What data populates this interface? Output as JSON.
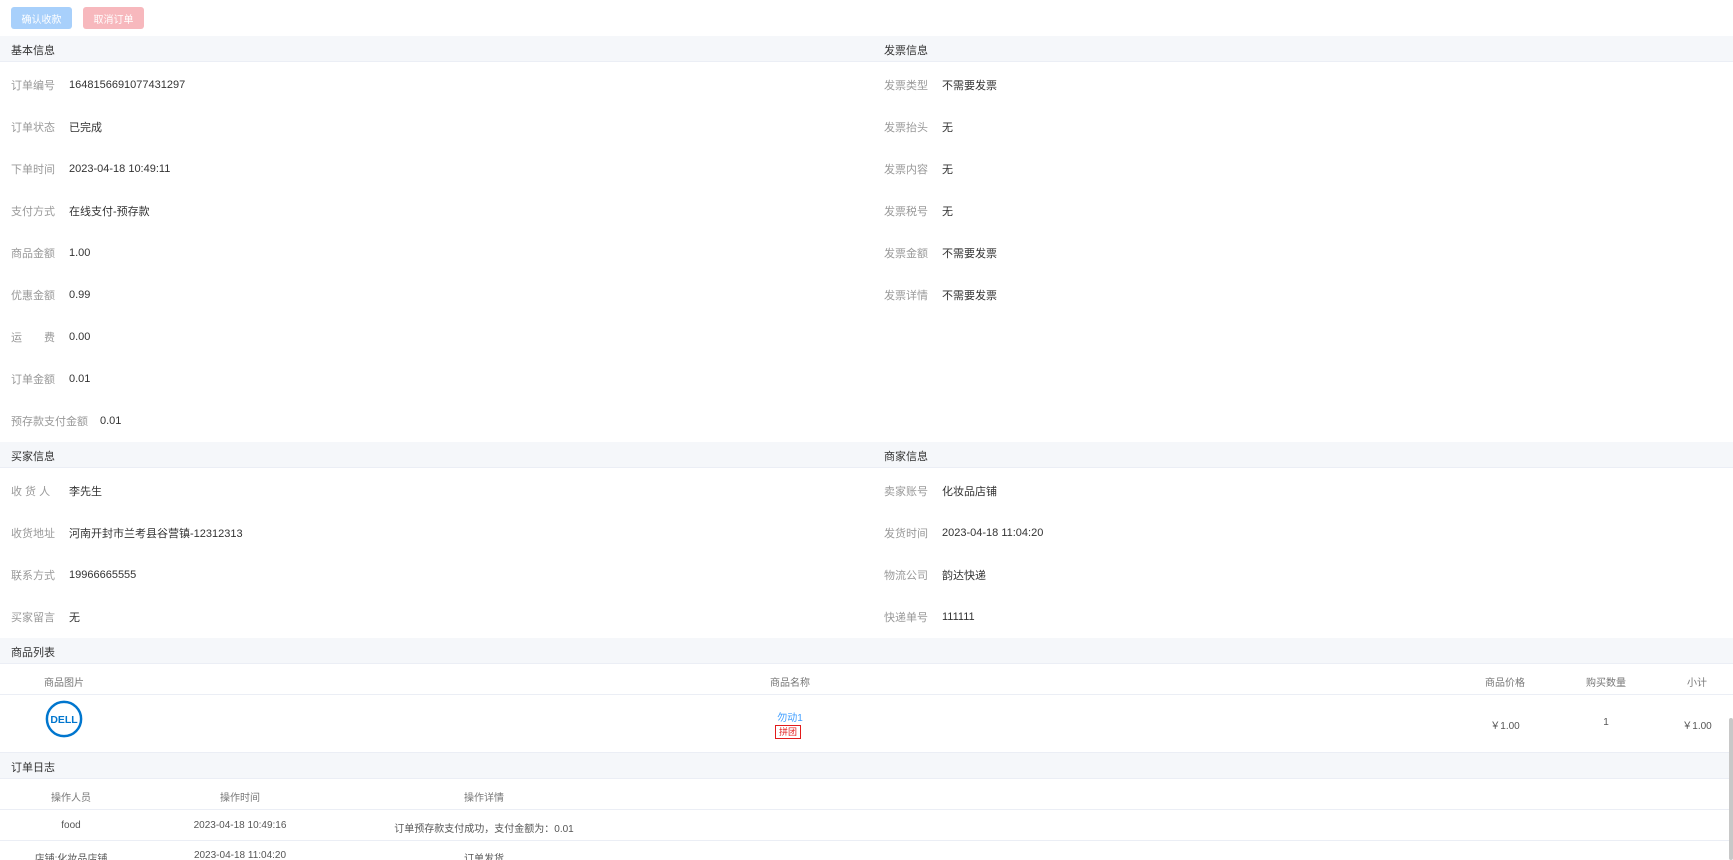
{
  "toolbar": {
    "confirm_label": "确认收款",
    "cancel_label": "取消订单"
  },
  "basic": {
    "title": "基本信息",
    "rows": [
      {
        "label": "订单编号",
        "value": "1648156691077431297"
      },
      {
        "label": "订单状态",
        "value": "已完成"
      },
      {
        "label": "下单时间",
        "value": "2023-04-18 10:49:11"
      },
      {
        "label": "支付方式",
        "value": "在线支付-预存款"
      },
      {
        "label": "商品金额",
        "value": "1.00"
      },
      {
        "label": "优惠金额",
        "value": "0.99"
      },
      {
        "label": "运　　费",
        "value": "0.00"
      },
      {
        "label": "订单金额",
        "value": "0.01"
      },
      {
        "label": "预存款支付金额",
        "value": "0.01"
      }
    ]
  },
  "invoice": {
    "title": "发票信息",
    "rows": [
      {
        "label": "发票类型",
        "value": "不需要发票"
      },
      {
        "label": "发票抬头",
        "value": "无"
      },
      {
        "label": "发票内容",
        "value": "无"
      },
      {
        "label": "发票税号",
        "value": "无"
      },
      {
        "label": "发票金额",
        "value": "不需要发票"
      },
      {
        "label": "发票详情",
        "value": "不需要发票"
      }
    ]
  },
  "buyer": {
    "title": "买家信息",
    "rows": [
      {
        "label": "收 货 人",
        "value": "李先生"
      },
      {
        "label": "收货地址",
        "value": "河南开封市兰考县谷营镇-12312313"
      },
      {
        "label": "联系方式",
        "value": "19966665555"
      },
      {
        "label": "买家留言",
        "value": "无"
      }
    ]
  },
  "seller": {
    "title": "商家信息",
    "rows": [
      {
        "label": "卖家账号",
        "value": "化妆品店铺"
      },
      {
        "label": "发货时间",
        "value": "2023-04-18 11:04:20"
      },
      {
        "label": "物流公司",
        "value": "韵达快递"
      },
      {
        "label": "快递单号",
        "value": "111111"
      }
    ]
  },
  "goods": {
    "title": "商品列表",
    "columns": [
      "商品图片",
      "商品名称",
      "商品价格",
      "购买数量",
      "小计"
    ],
    "items": [
      {
        "logo": "DELL",
        "name": "勿动1",
        "tag": "拼团",
        "price": "￥1.00",
        "qty": "1",
        "subtotal": "￥1.00"
      }
    ]
  },
  "log": {
    "title": "订单日志",
    "columns": [
      "操作人员",
      "操作时间",
      "操作详情"
    ],
    "rows": [
      {
        "operator": "food",
        "time": "2023-04-18 10:49:16",
        "detail": "订单预存款支付成功，支付金额为：0.01"
      },
      {
        "operator": "店铺:化妆品店铺",
        "time": "2023-04-18 11:04:20",
        "detail": "订单发货"
      }
    ]
  },
  "colors": {
    "primary_light": "#a8d0fb",
    "danger_light": "#f7b8bd",
    "link": "#409eff",
    "tag_red": "#e21b1b",
    "dell_blue": "#0076ce"
  }
}
